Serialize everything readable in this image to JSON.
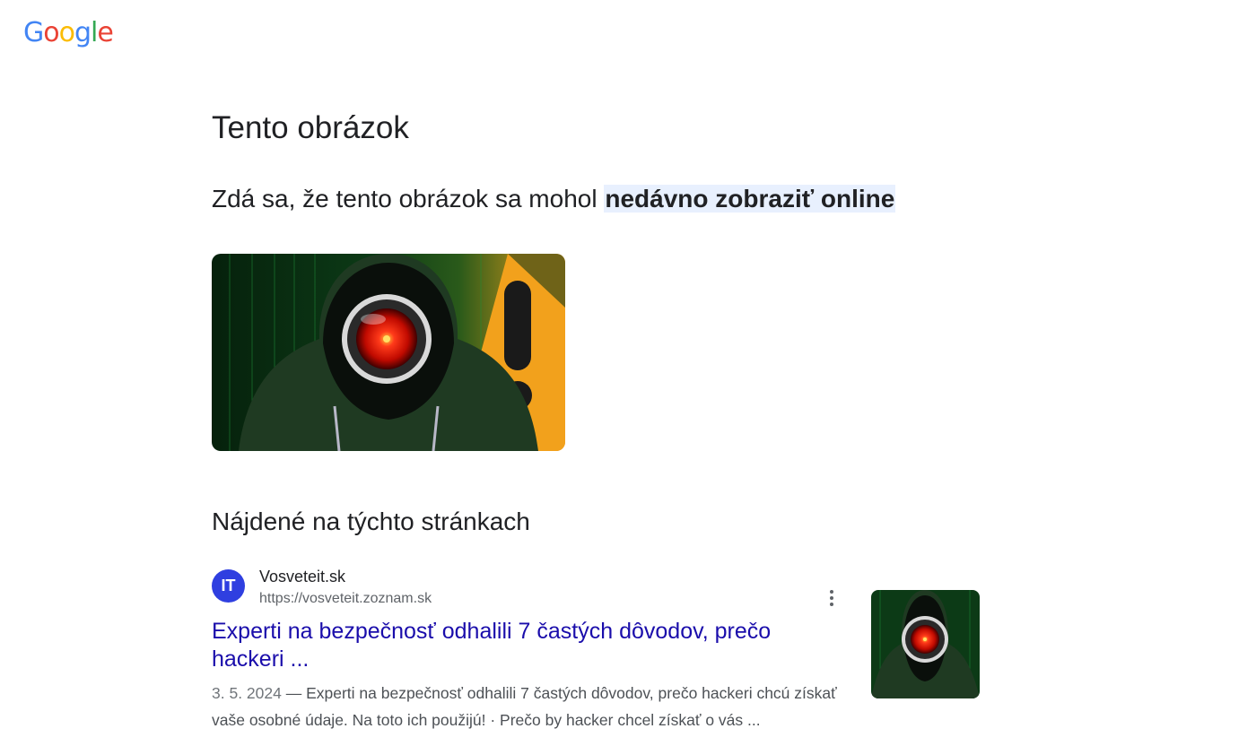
{
  "logo": {
    "letters": [
      "G",
      "o",
      "o",
      "g",
      "l",
      "e"
    ],
    "colors": [
      "#4285f4",
      "#ea4335",
      "#fbbc05",
      "#4285f4",
      "#34a853",
      "#ea4335"
    ]
  },
  "page": {
    "title": "Tento obrázok",
    "intro_prefix": "Zdá sa, že tento obrázok sa mohol ",
    "intro_highlight": "nedávno zobraziť online",
    "highlight_color": "#e8f0fe"
  },
  "main_image": {
    "icon": "hooded-hacker-red-eye-warning-image"
  },
  "section": {
    "title": "Nájdené na týchto stránkach"
  },
  "result": {
    "favicon_text": "IT",
    "favicon_color": "#2f3fe0",
    "site_name": "Vosveteit.sk",
    "url": "https://vosveteit.zoznam.sk",
    "title": "Experti na bezpečnosť odhalili 7 častých dôvodov, prečo hackeri ...",
    "date": "3. 5. 2024",
    "snippet": " — Experti na bezpečnosť odhalili 7 častých dôvodov, prečo hackeri chcú získať vaše osobné údaje. Na toto ich použijú! · Prečo by hacker chcel získať o vás ...",
    "more_icon": "more-vert-icon",
    "link_color": "#1a0dab"
  }
}
